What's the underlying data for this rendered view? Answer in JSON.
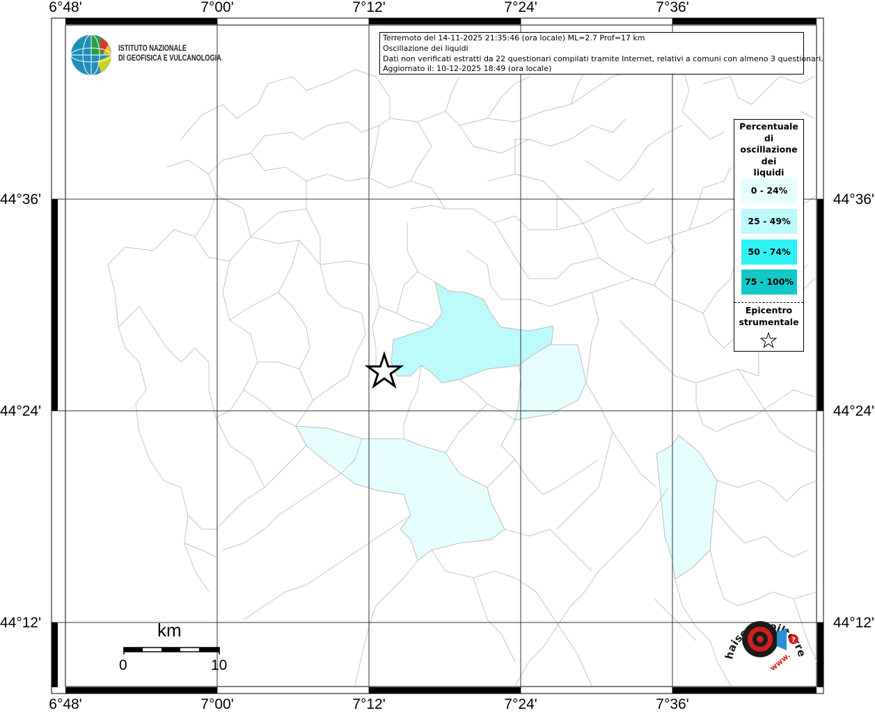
{
  "map": {
    "top_labels": [
      "6°48'",
      "7°00'",
      "7°12'",
      "7°24'",
      "7°36'"
    ],
    "bottom_labels": [
      "6°48'",
      "7°00'",
      "7°12'",
      "7°24'",
      "7°36'"
    ],
    "left_labels": [
      "44°36'",
      "44°24'",
      "44°12'"
    ],
    "right_labels": [
      "44°36'",
      "44°24'",
      "44°12'"
    ]
  },
  "info": {
    "line1": "Terremoto del 14-11-2025 21:35:46 (ora locale) ML=2.7 Prof=17 km",
    "line2": "Oscillazione dei liquidi",
    "line3": "Dati non verificati estratti da 22 questionari compilati tramite Internet, relativi a comuni con almeno 3 questionari.",
    "line4": "Aggiornato il: 10-12-2025 18:49 (ora locale)"
  },
  "logo": {
    "line1": "ISTITUTO NAZIONALE",
    "line2": "DI GEOFISICA E VULCANOLOGIA"
  },
  "legend": {
    "title_lines": [
      "Percentuale",
      "di",
      "oscillazione",
      "dei",
      "liquidi"
    ],
    "classes": [
      {
        "label": "0 - 24%",
        "color": "#e6fefe"
      },
      {
        "label": "25 - 49%",
        "color": "#bdfafc"
      },
      {
        "label": "50 - 74%",
        "color": "#2ff2f6"
      },
      {
        "label": "75 - 100%",
        "color": "#13c8c8"
      }
    ],
    "epicenter_lines": [
      "Epicentro",
      "strumentale"
    ]
  },
  "scale": {
    "unit": "km",
    "start": "0",
    "end": "10"
  },
  "brand": {
    "arc_text": "haisentitoilterremoto.it",
    "small_text": "www.",
    "mark": "?"
  },
  "colors": {
    "fill_level1": "#e6fefe",
    "fill_level2": "#bdfafc",
    "boundary": "#bdbdbd",
    "grid": "#333333"
  }
}
